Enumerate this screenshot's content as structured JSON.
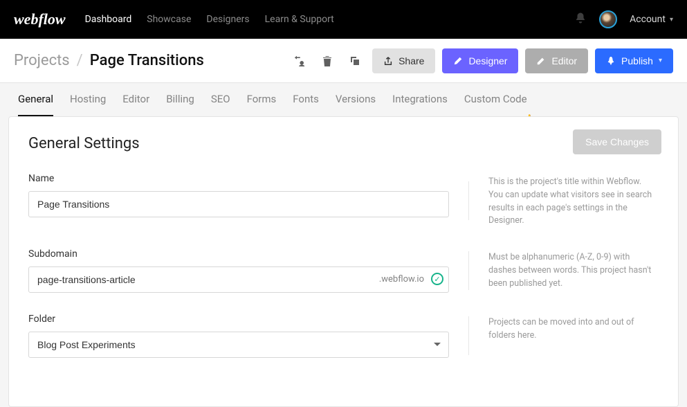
{
  "topbar": {
    "logo_text": "webflow",
    "nav": [
      {
        "label": "Dashboard",
        "active": true
      },
      {
        "label": "Showcase",
        "active": false
      },
      {
        "label": "Designers",
        "active": false
      },
      {
        "label": "Learn & Support",
        "active": false
      }
    ],
    "account_label": "Account"
  },
  "subheader": {
    "breadcrumb_root": "Projects",
    "breadcrumb_sep": "/",
    "breadcrumb_current": "Page Transitions",
    "share_label": "Share",
    "designer_label": "Designer",
    "editor_label": "Editor",
    "publish_label": "Publish"
  },
  "tabs": [
    {
      "label": "General",
      "active": true
    },
    {
      "label": "Hosting",
      "active": false
    },
    {
      "label": "Editor",
      "active": false
    },
    {
      "label": "Billing",
      "active": false
    },
    {
      "label": "SEO",
      "active": false
    },
    {
      "label": "Forms",
      "active": false
    },
    {
      "label": "Fonts",
      "active": false
    },
    {
      "label": "Versions",
      "active": false
    },
    {
      "label": "Integrations",
      "active": false
    },
    {
      "label": "Custom Code",
      "active": false
    }
  ],
  "card": {
    "title": "General Settings",
    "save_label": "Save Changes",
    "name_label": "Name",
    "name_value": "Page Transitions",
    "name_help": "This is the project's title within Webflow. You can update what visitors see in search results in each page's settings in the Designer.",
    "subdomain_label": "Subdomain",
    "subdomain_value": "page-transitions-article",
    "subdomain_suffix": ".webflow.io",
    "subdomain_help": "Must be alphanumeric (A-Z, 0-9) with dashes between words. This project hasn't been published yet.",
    "folder_label": "Folder",
    "folder_value": "Blog Post Experiments",
    "folder_help": "Projects can be moved into and out of folders here."
  },
  "icons": {
    "bell": "bell",
    "transfer": "transfer-user",
    "trash": "trash",
    "duplicate": "duplicate",
    "share": "share",
    "pencil": "pencil",
    "rocket": "rocket",
    "check": "✓"
  }
}
